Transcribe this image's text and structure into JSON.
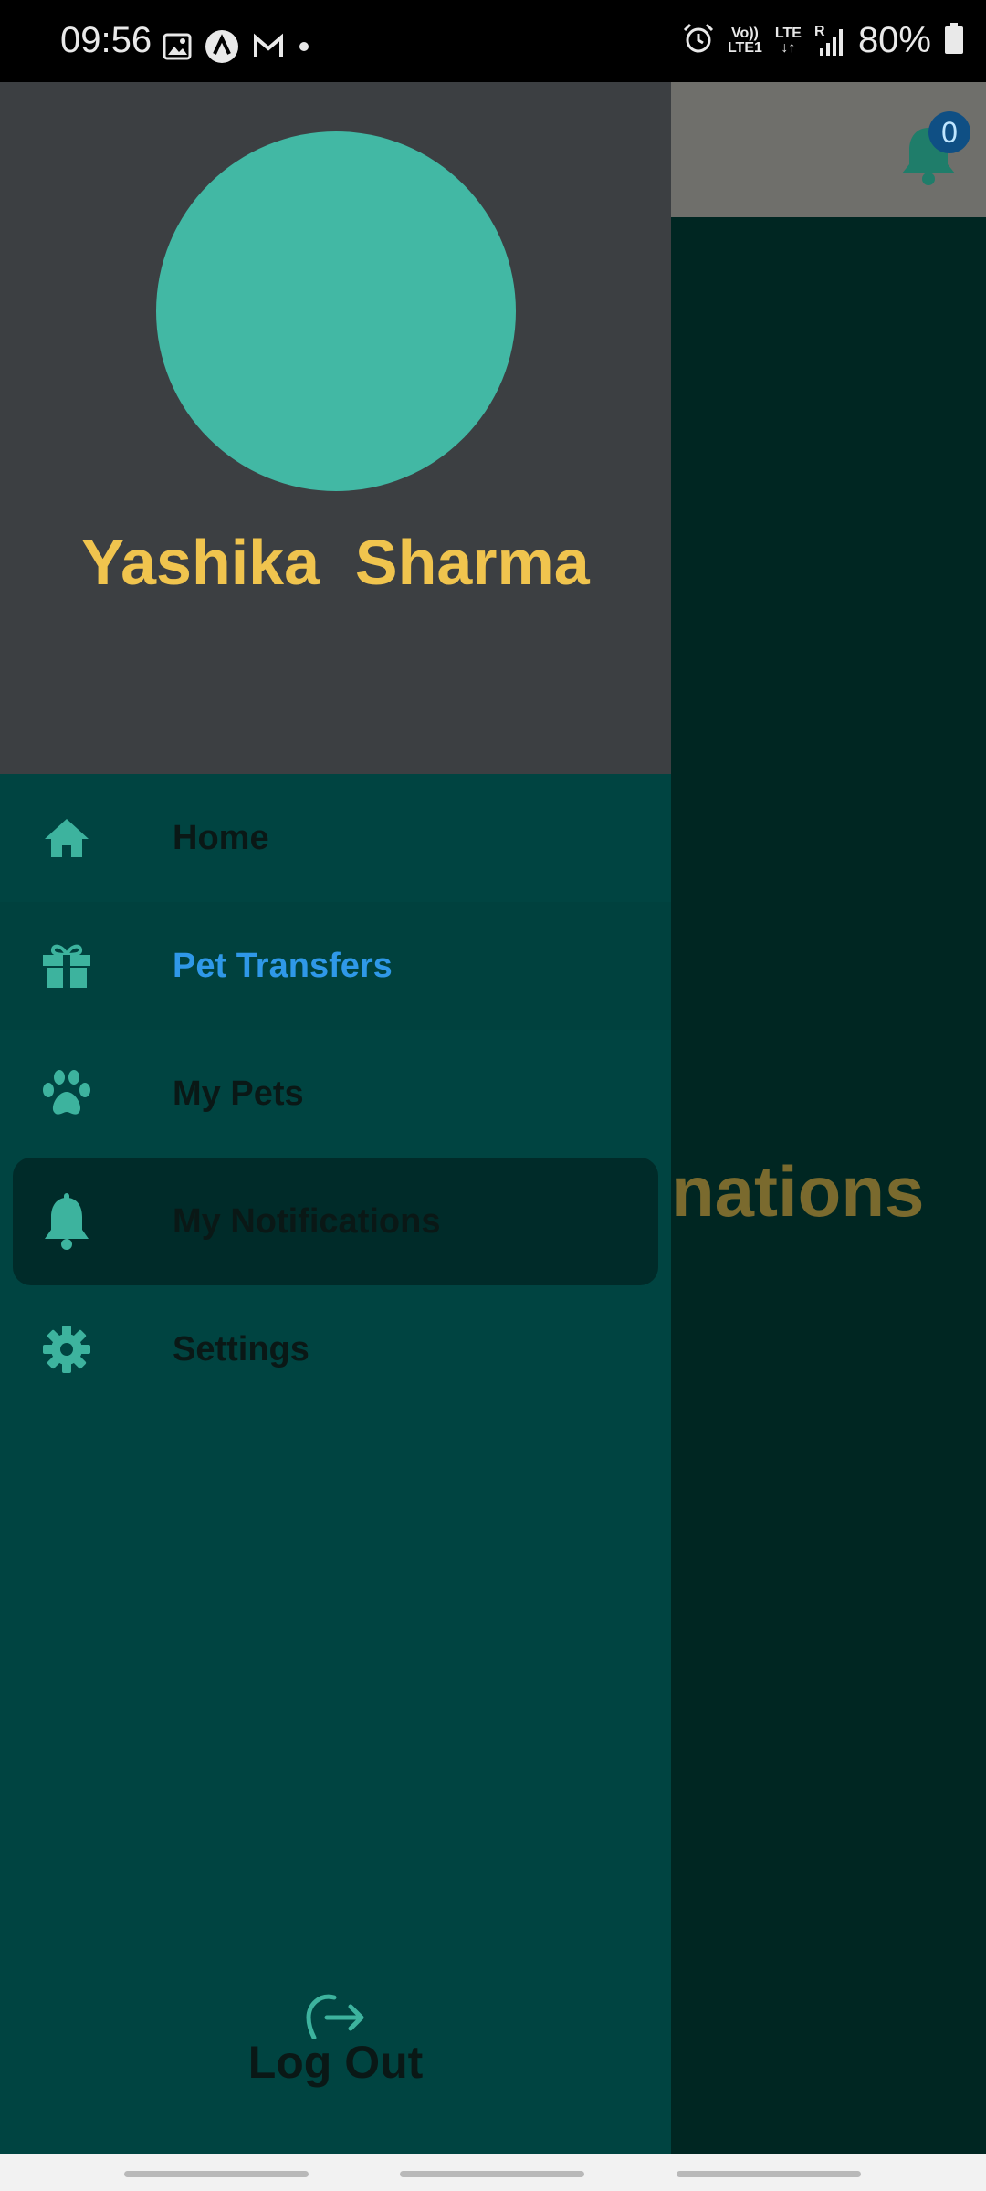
{
  "status_bar": {
    "time": "09:56",
    "left_icons": [
      "image-icon",
      "a-logo-icon",
      "mail-m-icon",
      "dot-icon"
    ],
    "right_icons": [
      "alarm-icon",
      "volte-icon",
      "lte-data-icon",
      "signal-icon",
      "battery-icon"
    ],
    "volte_top": "Vo))",
    "volte_bottom": "LTE1",
    "lte_label": "LTE",
    "roaming_label": "R",
    "battery": "80%"
  },
  "app": {
    "notification_count": "0",
    "heading_partial": "nations",
    "colors": {
      "topbar": "#6f6f6b",
      "background": "#002622",
      "heading": "#7a6a2e"
    }
  },
  "drawer": {
    "user_name": "Yashika  Sharma",
    "menu": [
      {
        "label": "Home",
        "icon": "home-icon"
      },
      {
        "label": "Pet Transfers",
        "icon": "gift-icon",
        "selected": true
      },
      {
        "label": "My Pets",
        "icon": "paw-icon"
      },
      {
        "label": "My Notifications",
        "icon": "bell-icon",
        "pressed": true
      },
      {
        "label": "Settings",
        "icon": "gear-icon"
      }
    ],
    "logout_label": "Log Out",
    "colors": {
      "header": "#3c3f42",
      "body": "#004441",
      "avatar": "#42b8a4",
      "name": "#f0c44e",
      "icon": "#3db39e",
      "selected_label": "#2f98e8"
    }
  }
}
